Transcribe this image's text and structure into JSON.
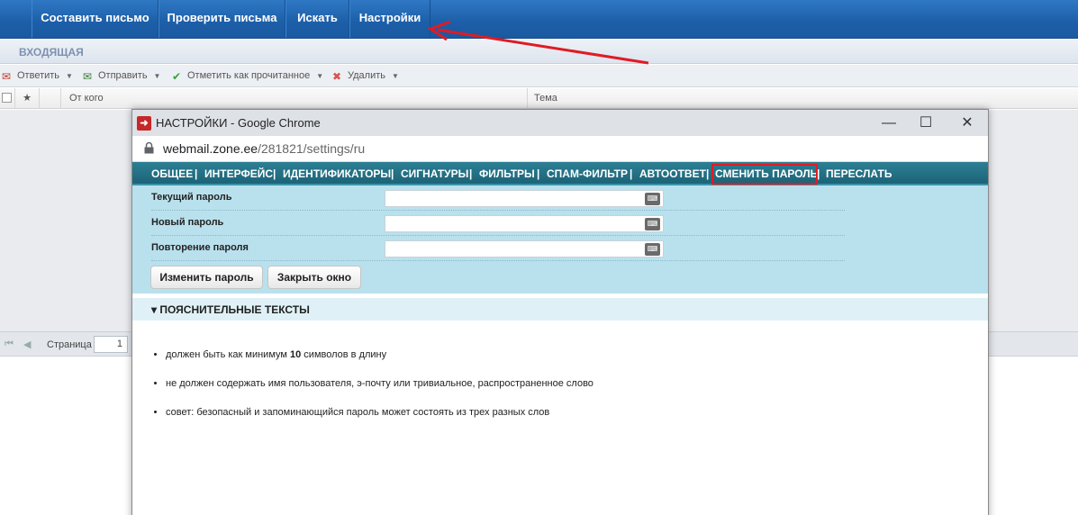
{
  "topnav": {
    "compose": "Составить письмо",
    "check": "Проверить письма",
    "search": "Искать",
    "settings": "Настройки"
  },
  "folder": "ВХОДЯЩАЯ",
  "toolbar": {
    "reply": "Ответить",
    "forward": "Отправить",
    "mark_read": "Отметить как прочитанное",
    "delete": "Удалить"
  },
  "grid": {
    "star": "★",
    "from": "От кого",
    "subject": "Тема"
  },
  "pager": {
    "label": "Страница",
    "page": "1"
  },
  "popup": {
    "title": "НАСТРОЙКИ - Google Chrome",
    "url_host": "webmail.zone.ee",
    "url_path": "/281821/settings/ru",
    "tabs": [
      "ОБЩЕЕ",
      "ИНТЕРФЕЙС",
      "ИДЕНТИФИКАТОРЫ",
      "СИГНАТУРЫ",
      "ФИЛЬТРЫ",
      "СПАМ-ФИЛЬТР",
      "АВТООТВЕТ",
      "СМЕНИТЬ ПАРОЛЬ",
      "ПЕРЕСЛАТЬ"
    ],
    "active_tab": "СМЕНИТЬ ПАРОЛЬ",
    "fields": {
      "current": "Текущий пароль",
      "new": "Новый пароль",
      "repeat": "Повторение пароля"
    },
    "buttons": {
      "change": "Изменить пароль",
      "close": "Закрыть окно"
    },
    "explain_header": "▾ ПОЯСНИТЕЛЬНЫЕ ТЕКСТЫ",
    "tips": {
      "tip1_pre": "должен быть как минимум ",
      "tip1_num": "10",
      "tip1_post": " символов в длину",
      "tip2": "не должен содержать имя пользователя, э-почту или тривиальное, распространенное слово",
      "tip3": "совет: безопасный и запоминающийся пароль может состоять из трех разных слов"
    }
  },
  "colors": {
    "highlight": "#e01b24",
    "tabbar": "#1c6377",
    "form_bg": "#b9e1ed"
  }
}
